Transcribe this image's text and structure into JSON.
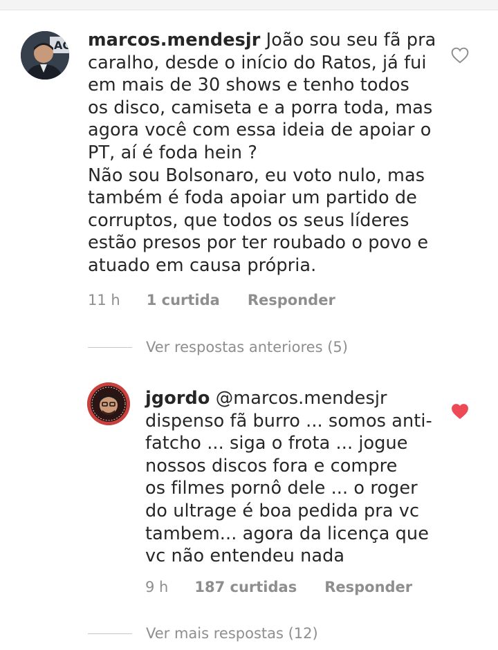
{
  "comment": {
    "username": "marcos.mendesjr",
    "text": "João sou seu fã pra\ncaralho, desde o início do Ratos, já fui\nem mais de 30 shows e tenho todos\nos disco, camiseta e a porra toda, mas\nagora você com essa ideia de apoiar o\nPT, aí é foda hein ?\nNão sou Bolsonaro, eu voto nulo, mas\ntambém é foda apoiar um partido de\ncorruptos, que todos os seus líderes\nestão presos por ter roubado o povo e\natuado em causa própria.",
    "time": "11 h",
    "likes": "1 curtida",
    "reply_label": "Responder",
    "liked": false
  },
  "previous_replies_label": "Ver respostas anteriores (5)",
  "reply": {
    "username": "jgordo",
    "mention": "@marcos.mendesjr",
    "text": "dispenso fã burro ... somos anti-\nfatcho ... siga o frota ... jogue\nnossos discos fora e compre\nos filmes pornô dele ... o roger\ndo ultrage é  boa pedida pra vc\ntambem... agora da licença que\nvc não entendeu nada",
    "time": "9 h",
    "likes": "187 curtidas",
    "reply_label": "Responder",
    "liked": true
  },
  "more_replies_label": "Ver mais respostas (12)",
  "colors": {
    "text": "#262626",
    "muted": "#8e8e8e",
    "heart_liked": "#ed4956",
    "heart_outline": "#8e8e8e"
  },
  "icons": {
    "like_outline": "heart-outline-icon",
    "like_filled": "heart-filled-icon"
  }
}
